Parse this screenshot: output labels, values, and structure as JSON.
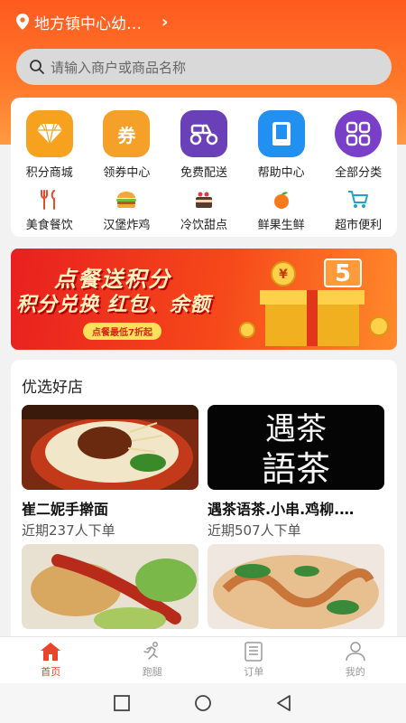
{
  "header": {
    "location": "地方镇中心幼…"
  },
  "search": {
    "placeholder": "请输入商户或商品名称"
  },
  "categories_main": [
    {
      "label": "积分商城",
      "icon": "diamond-icon",
      "color": "#f6a21e"
    },
    {
      "label": "领券中心",
      "icon": "coupon-icon",
      "color": "#f5a028"
    },
    {
      "label": "免费配送",
      "icon": "scooter-icon",
      "color": "#6a40b8"
    },
    {
      "label": "帮助中心",
      "icon": "book-icon",
      "color": "#2290f0"
    },
    {
      "label": "全部分类",
      "icon": "grid-icon",
      "color": "#7a3fc8"
    }
  ],
  "categories_sub": [
    {
      "label": "美食餐饮",
      "icon": "fork-knife-icon"
    },
    {
      "label": "汉堡炸鸡",
      "icon": "burger-icon"
    },
    {
      "label": "冷饮甜点",
      "icon": "cake-icon"
    },
    {
      "label": "鲜果生鲜",
      "icon": "fruit-icon"
    },
    {
      "label": "超市便利",
      "icon": "cart-icon"
    }
  ],
  "banner": {
    "title": "点餐送积分",
    "subtitle": "积分兑换 红包、余额",
    "pill": "点餐最低7折起"
  },
  "shops_section": {
    "heading": "优选好店",
    "shops": [
      {
        "name": "崔二妮手擀面",
        "sub": "近期237人下单"
      },
      {
        "name": "遇茶语茶.小串.鸡柳.…",
        "sub": "近期507人下单",
        "logo_text": "遇茶\n語茶"
      },
      {
        "name": "",
        "sub": ""
      },
      {
        "name": "",
        "sub": ""
      }
    ]
  },
  "tabs": [
    {
      "label": "首页",
      "active": true
    },
    {
      "label": "跑腿",
      "active": false
    },
    {
      "label": "订单",
      "active": false
    },
    {
      "label": "我的",
      "active": false
    }
  ]
}
